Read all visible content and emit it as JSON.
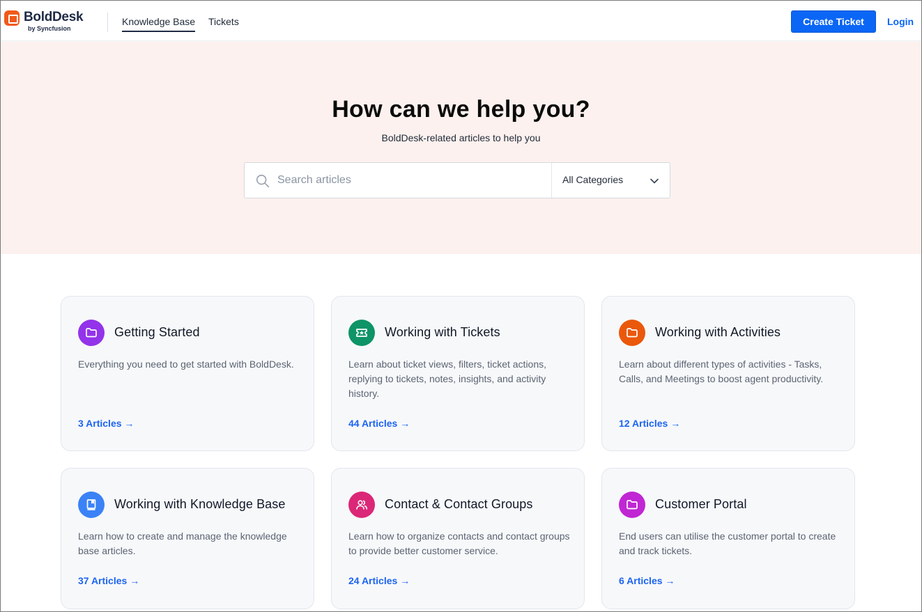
{
  "header": {
    "brand": {
      "name": "BoldDesk",
      "byline": "by Syncfusion",
      "logo_icon": "bolddesk-logo-icon",
      "color": "#f05a1a"
    },
    "nav": [
      {
        "label": "Knowledge Base",
        "active": true
      },
      {
        "label": "Tickets",
        "active": false
      }
    ],
    "create_ticket_label": "Create Ticket",
    "login_label": "Login",
    "accent_color": "#0b66f5"
  },
  "hero": {
    "title": "How can we help you?",
    "subtitle": "BoldDesk-related articles to help you",
    "search": {
      "icon": "search-icon",
      "placeholder": "Search articles",
      "value": ""
    },
    "category_select": {
      "selected": "All Categories",
      "icon": "chevron-down-icon"
    },
    "background": "#fcf1ee"
  },
  "categories": [
    {
      "title": "Getting Started",
      "description": "Everything you need to get started with BoldDesk.",
      "articles": "3 Articles",
      "arrow": "→",
      "icon": "folder-icon",
      "color": "#9333ea"
    },
    {
      "title": "Working with Tickets",
      "description": "Learn about ticket views, filters, ticket actions, replying to tickets, notes, insights, and activity history.",
      "articles": "44 Articles",
      "arrow": "→",
      "icon": "ticket-icon",
      "color": "#0e9466"
    },
    {
      "title": "Working with Activities",
      "description": "Learn about different types of activities - Tasks, Calls, and Meetings to boost agent productivity.",
      "articles": "12 Articles",
      "arrow": "→",
      "icon": "folder-icon",
      "color": "#ea580c"
    },
    {
      "title": "Working with Knowledge Base",
      "description": "Learn how to create and manage the knowledge base articles.",
      "articles": "37 Articles",
      "arrow": "→",
      "icon": "book-icon",
      "color": "#3b82f6"
    },
    {
      "title": "Contact & Contact Groups",
      "description": "Learn how to organize contacts and contact groups to provide better customer service.",
      "articles": "24 Articles",
      "arrow": "→",
      "icon": "users-icon",
      "color": "#db2777"
    },
    {
      "title": "Customer Portal",
      "description": "End users can utilise the customer portal to create and track tickets.",
      "articles": "6 Articles",
      "arrow": "→",
      "icon": "folder-icon",
      "color": "#c026d3"
    }
  ]
}
